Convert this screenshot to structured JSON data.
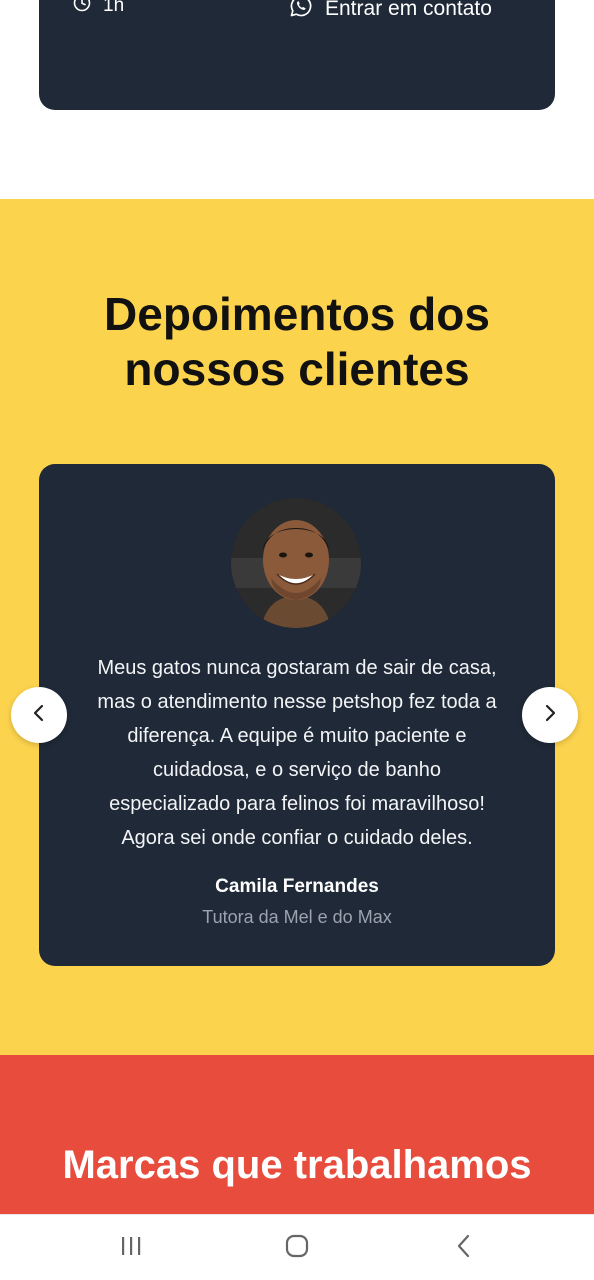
{
  "service_card": {
    "duration": "1h",
    "duration_icon": "clock-icon",
    "contact_label": "Entrar em contato",
    "contact_icon": "whatsapp-icon"
  },
  "testimonials": {
    "title_line1": "Depoimentos dos",
    "title_line2": "nossos clientes",
    "quote_line1": "Meus gatos nunca gostaram de sair de casa,",
    "quote_line2": "mas o atendimento nesse petshop fez toda a",
    "quote_line3": "diferença. A equipe é muito paciente e",
    "quote_line4": "cuidadosa, e o serviço de banho",
    "quote_line5": "especializado para felinos foi maravilhoso!",
    "quote_line6": "Agora sei onde confiar o cuidado deles.",
    "author_name": "Camila Fernandes",
    "author_role": "Tutora da Mel e do Max",
    "prev_icon": "chevron-left-icon",
    "next_icon": "chevron-right-icon"
  },
  "brands": {
    "title": "Marcas que trabalhamos"
  },
  "android_nav": {
    "recent_icon": "recent-apps-icon",
    "home_icon": "home-icon",
    "back_icon": "back-icon"
  },
  "colors": {
    "dark_card": "#1f2937",
    "yellow": "#fcd34d",
    "red": "#e74c3c"
  }
}
